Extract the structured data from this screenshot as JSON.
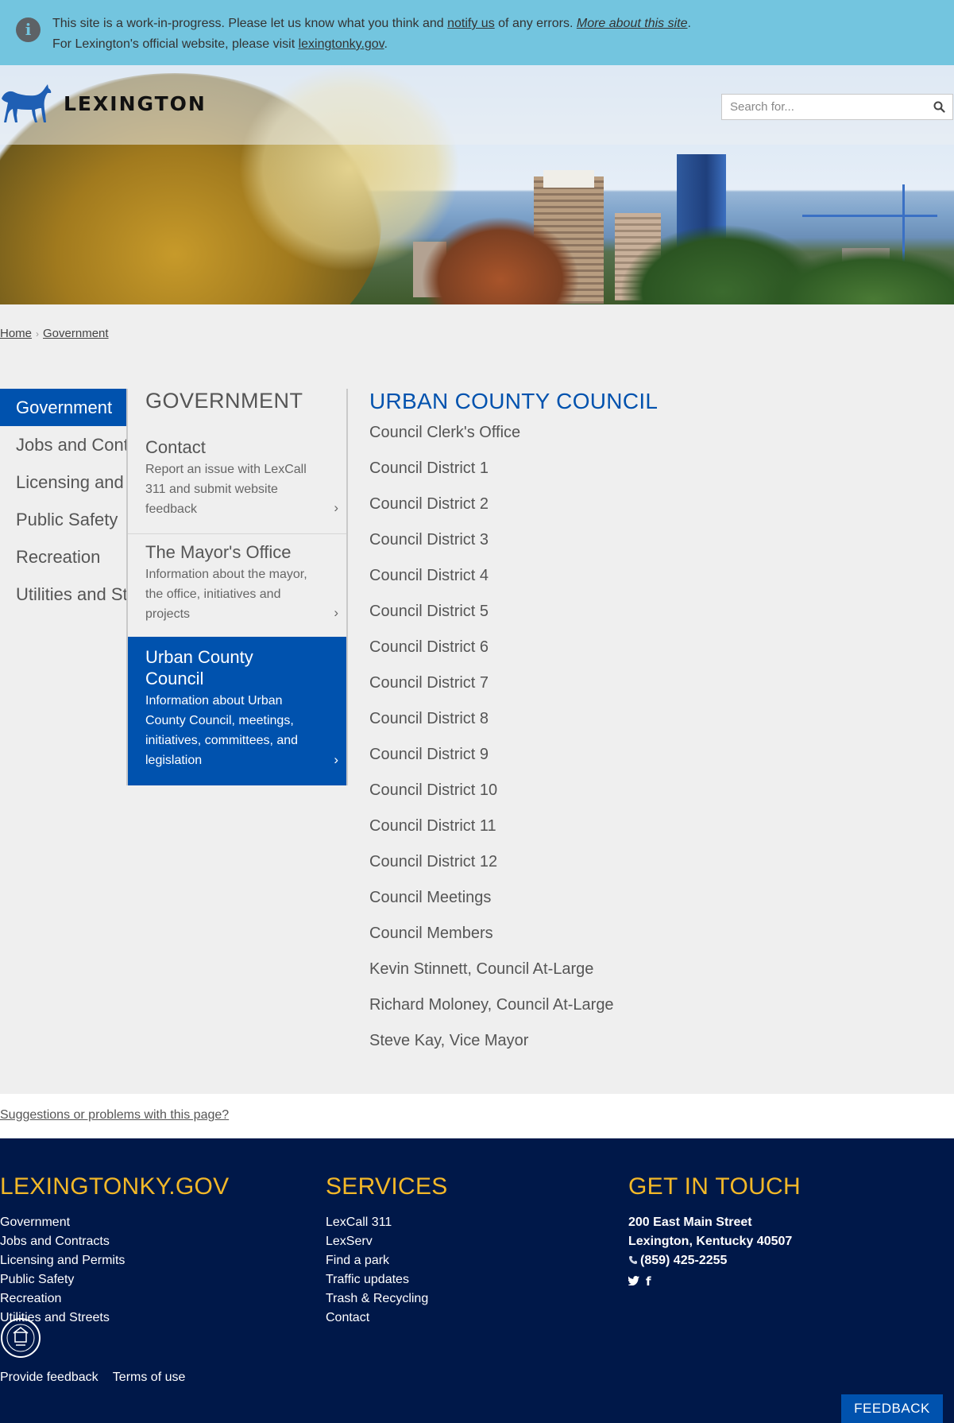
{
  "notice": {
    "text1": "This site is a work-in-progress. Please let us know what you think and ",
    "notify_link": "notify us",
    "text2": " of any errors. ",
    "more_link": "More about this site",
    "text3": ".",
    "text4": "For Lexington's official website, please visit ",
    "site_link": "lexingtonky.gov",
    "text5": "."
  },
  "header": {
    "logo_text": "LEXINGTON",
    "search_placeholder": "Search for..."
  },
  "breadcrumb": [
    "Home",
    "Government"
  ],
  "left_nav": [
    "Government",
    "Jobs and Contracts",
    "Licensing and Permits",
    "Public Safety",
    "Recreation",
    "Utilities and Streets"
  ],
  "panel": {
    "title": "GOVERNMENT",
    "cards": [
      {
        "title": "Contact",
        "desc_lines": [
          "Report an issue with LexCall",
          "311 and submit website",
          "feedback"
        ]
      },
      {
        "title": "The Mayor's Office",
        "desc_lines": [
          "Information about the mayor,",
          "the office, initiatives and",
          "projects"
        ]
      },
      {
        "title_lines": [
          "Urban County",
          "Council"
        ],
        "desc_lines": [
          "Information about Urban",
          "County Council, meetings,",
          "initiatives, committees, and",
          "legislation"
        ]
      }
    ],
    "chevron": "›"
  },
  "council": {
    "title": "URBAN COUNTY COUNCIL",
    "items": [
      "Council Clerk's Office",
      "Council District 1",
      "Council District 2",
      "Council District 3",
      "Council District 4",
      "Council District 5",
      "Council District 6",
      "Council District 7",
      "Council District 8",
      "Council District 9",
      "Council District 10",
      "Council District 11",
      "Council District 12",
      "Council Meetings",
      "Council Members",
      "Kevin Stinnett, Council At-Large",
      "Richard Moloney, Council At-Large",
      "Steve Kay, Vice Mayor"
    ]
  },
  "suggest_link": "Suggestions or problems with this page?",
  "footer": {
    "col1": {
      "title": "LEXINGTONKY.GOV",
      "links": [
        "Government",
        "Jobs and Contracts",
        "Licensing and Permits",
        "Public Safety",
        "Recreation",
        "Utilities and Streets"
      ]
    },
    "col2": {
      "title": "SERVICES",
      "links": [
        "LexCall 311",
        "LexServ",
        "Find a park",
        "Traffic updates",
        "Trash & Recycling",
        "Contact"
      ]
    },
    "col3": {
      "title": "GET IN TOUCH",
      "address1": "200 East Main Street",
      "address2": "Lexington, Kentucky 40507",
      "phone": "(859) 425-2255"
    },
    "bottom_links": [
      "Provide feedback",
      "Terms of use"
    ],
    "feedback_button": "FEEDBACK"
  },
  "colors": {
    "primary": "#0052ae",
    "footer_bg": "#001849",
    "footer_heading": "#f3b828",
    "notice_bg": "#73c5df"
  },
  "icons": [
    "info-icon",
    "horse-logo-icon",
    "search-icon",
    "phone-icon",
    "twitter-icon",
    "facebook-icon",
    "city-seal-icon",
    "chevron-right-icon"
  ]
}
